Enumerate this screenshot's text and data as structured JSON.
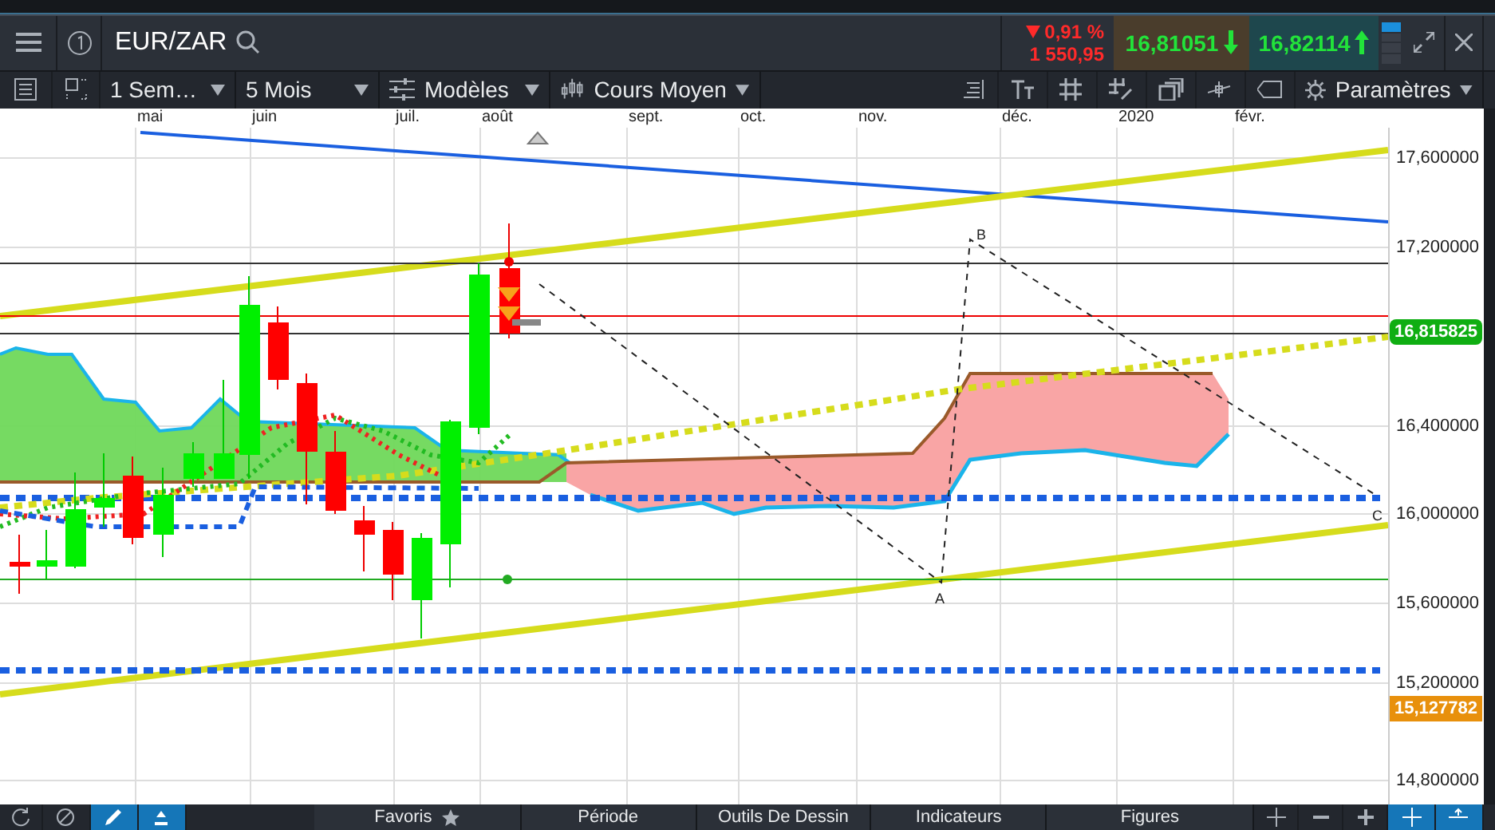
{
  "header": {
    "symbol": "EUR/ZAR",
    "change": {
      "rising": false,
      "percent": "0,91 %",
      "points": "1 550,95"
    },
    "sell": {
      "price": "16,81051",
      "rising": false
    },
    "buy": {
      "price": "16,82114",
      "rising": true
    }
  },
  "toolbar": {
    "dropdowns": [
      {
        "label": "1 Sem…",
        "kind": "plain"
      },
      {
        "label": "5 Mois",
        "kind": "plain"
      },
      {
        "label": "Modèles",
        "kind": "templates"
      },
      {
        "label": "Cours Moyen",
        "kind": "candles"
      }
    ],
    "settings": "Paramètres"
  },
  "chart": {
    "months": [
      "mai",
      "juin",
      "juil.",
      "août",
      "sept.",
      "oct.",
      "nov.",
      "déc.",
      "2020",
      "févr."
    ],
    "price_ticks": [
      "17,600000",
      "17,200000",
      "16,400000",
      "16,000000",
      "15,600000",
      "15,200000",
      "14,800000"
    ],
    "current_price": "16,815825",
    "low_price": "15,127782",
    "pattern_labels": [
      "A",
      "B",
      "C"
    ]
  },
  "bottom_tabs": [
    {
      "label": "Favoris",
      "kind": "starred"
    },
    {
      "label": "Période",
      "kind": "plain"
    },
    {
      "label": "Outils De Dessin",
      "kind": "plain"
    },
    {
      "label": "Indicateurs",
      "kind": "plain"
    },
    {
      "label": "Figures",
      "kind": "plain"
    }
  ]
}
